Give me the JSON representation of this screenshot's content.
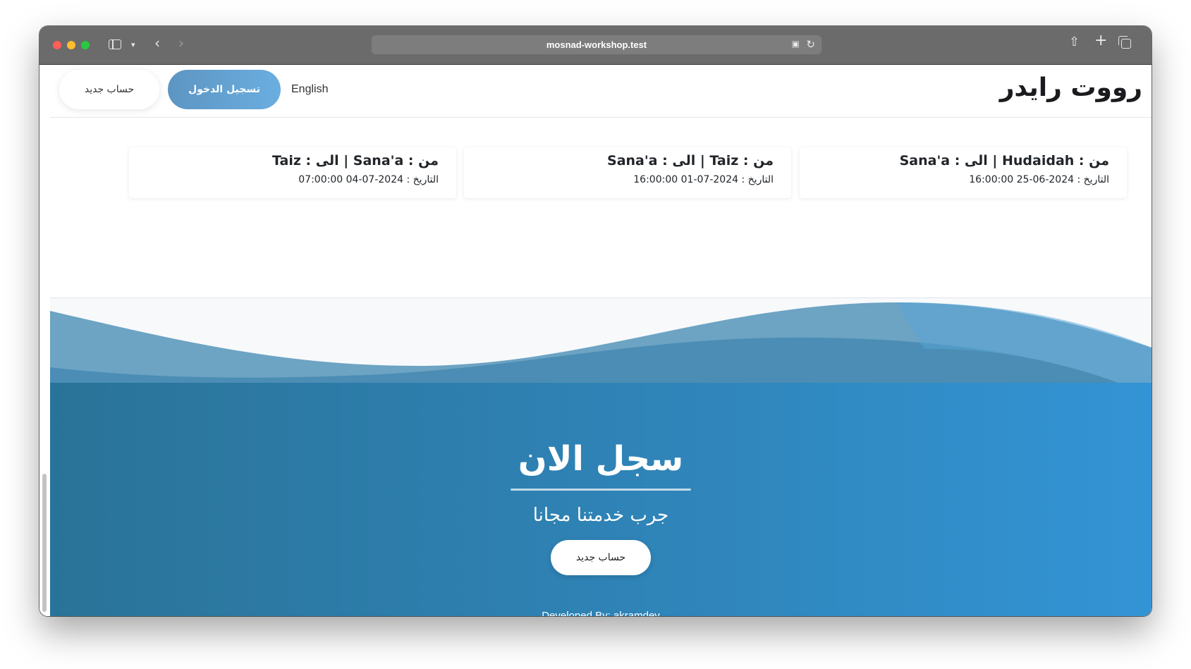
{
  "browser": {
    "url": "mosnad-workshop.test"
  },
  "navbar": {
    "brand": "رووت رايدر",
    "login_label": "تسجيل الدخول",
    "register_label": "حساب جديد",
    "language_label": "English"
  },
  "trips": [
    {
      "title": "من : Hudaidah | الى : Sana'a",
      "date": "التاريخ : 2024-06-25 16:00:00"
    },
    {
      "title": "من : Taiz | الى : Sana'a",
      "date": "التاريخ : 2024-07-01 16:00:00"
    },
    {
      "title": "من : Sana'a | الى : Taiz",
      "date": "التاريخ : 2024-07-04 07:00:00"
    }
  ],
  "cta": {
    "title": "سجل الان",
    "subtitle": "جرب خدمتنا مجانا",
    "button_label": "حساب جديد"
  },
  "footer": {
    "credit": "Developed By: akramdev"
  },
  "colors": {
    "accent": "#6aaee0",
    "cta_gradient_start": "#2a7398",
    "cta_gradient_end": "#3394d5"
  }
}
